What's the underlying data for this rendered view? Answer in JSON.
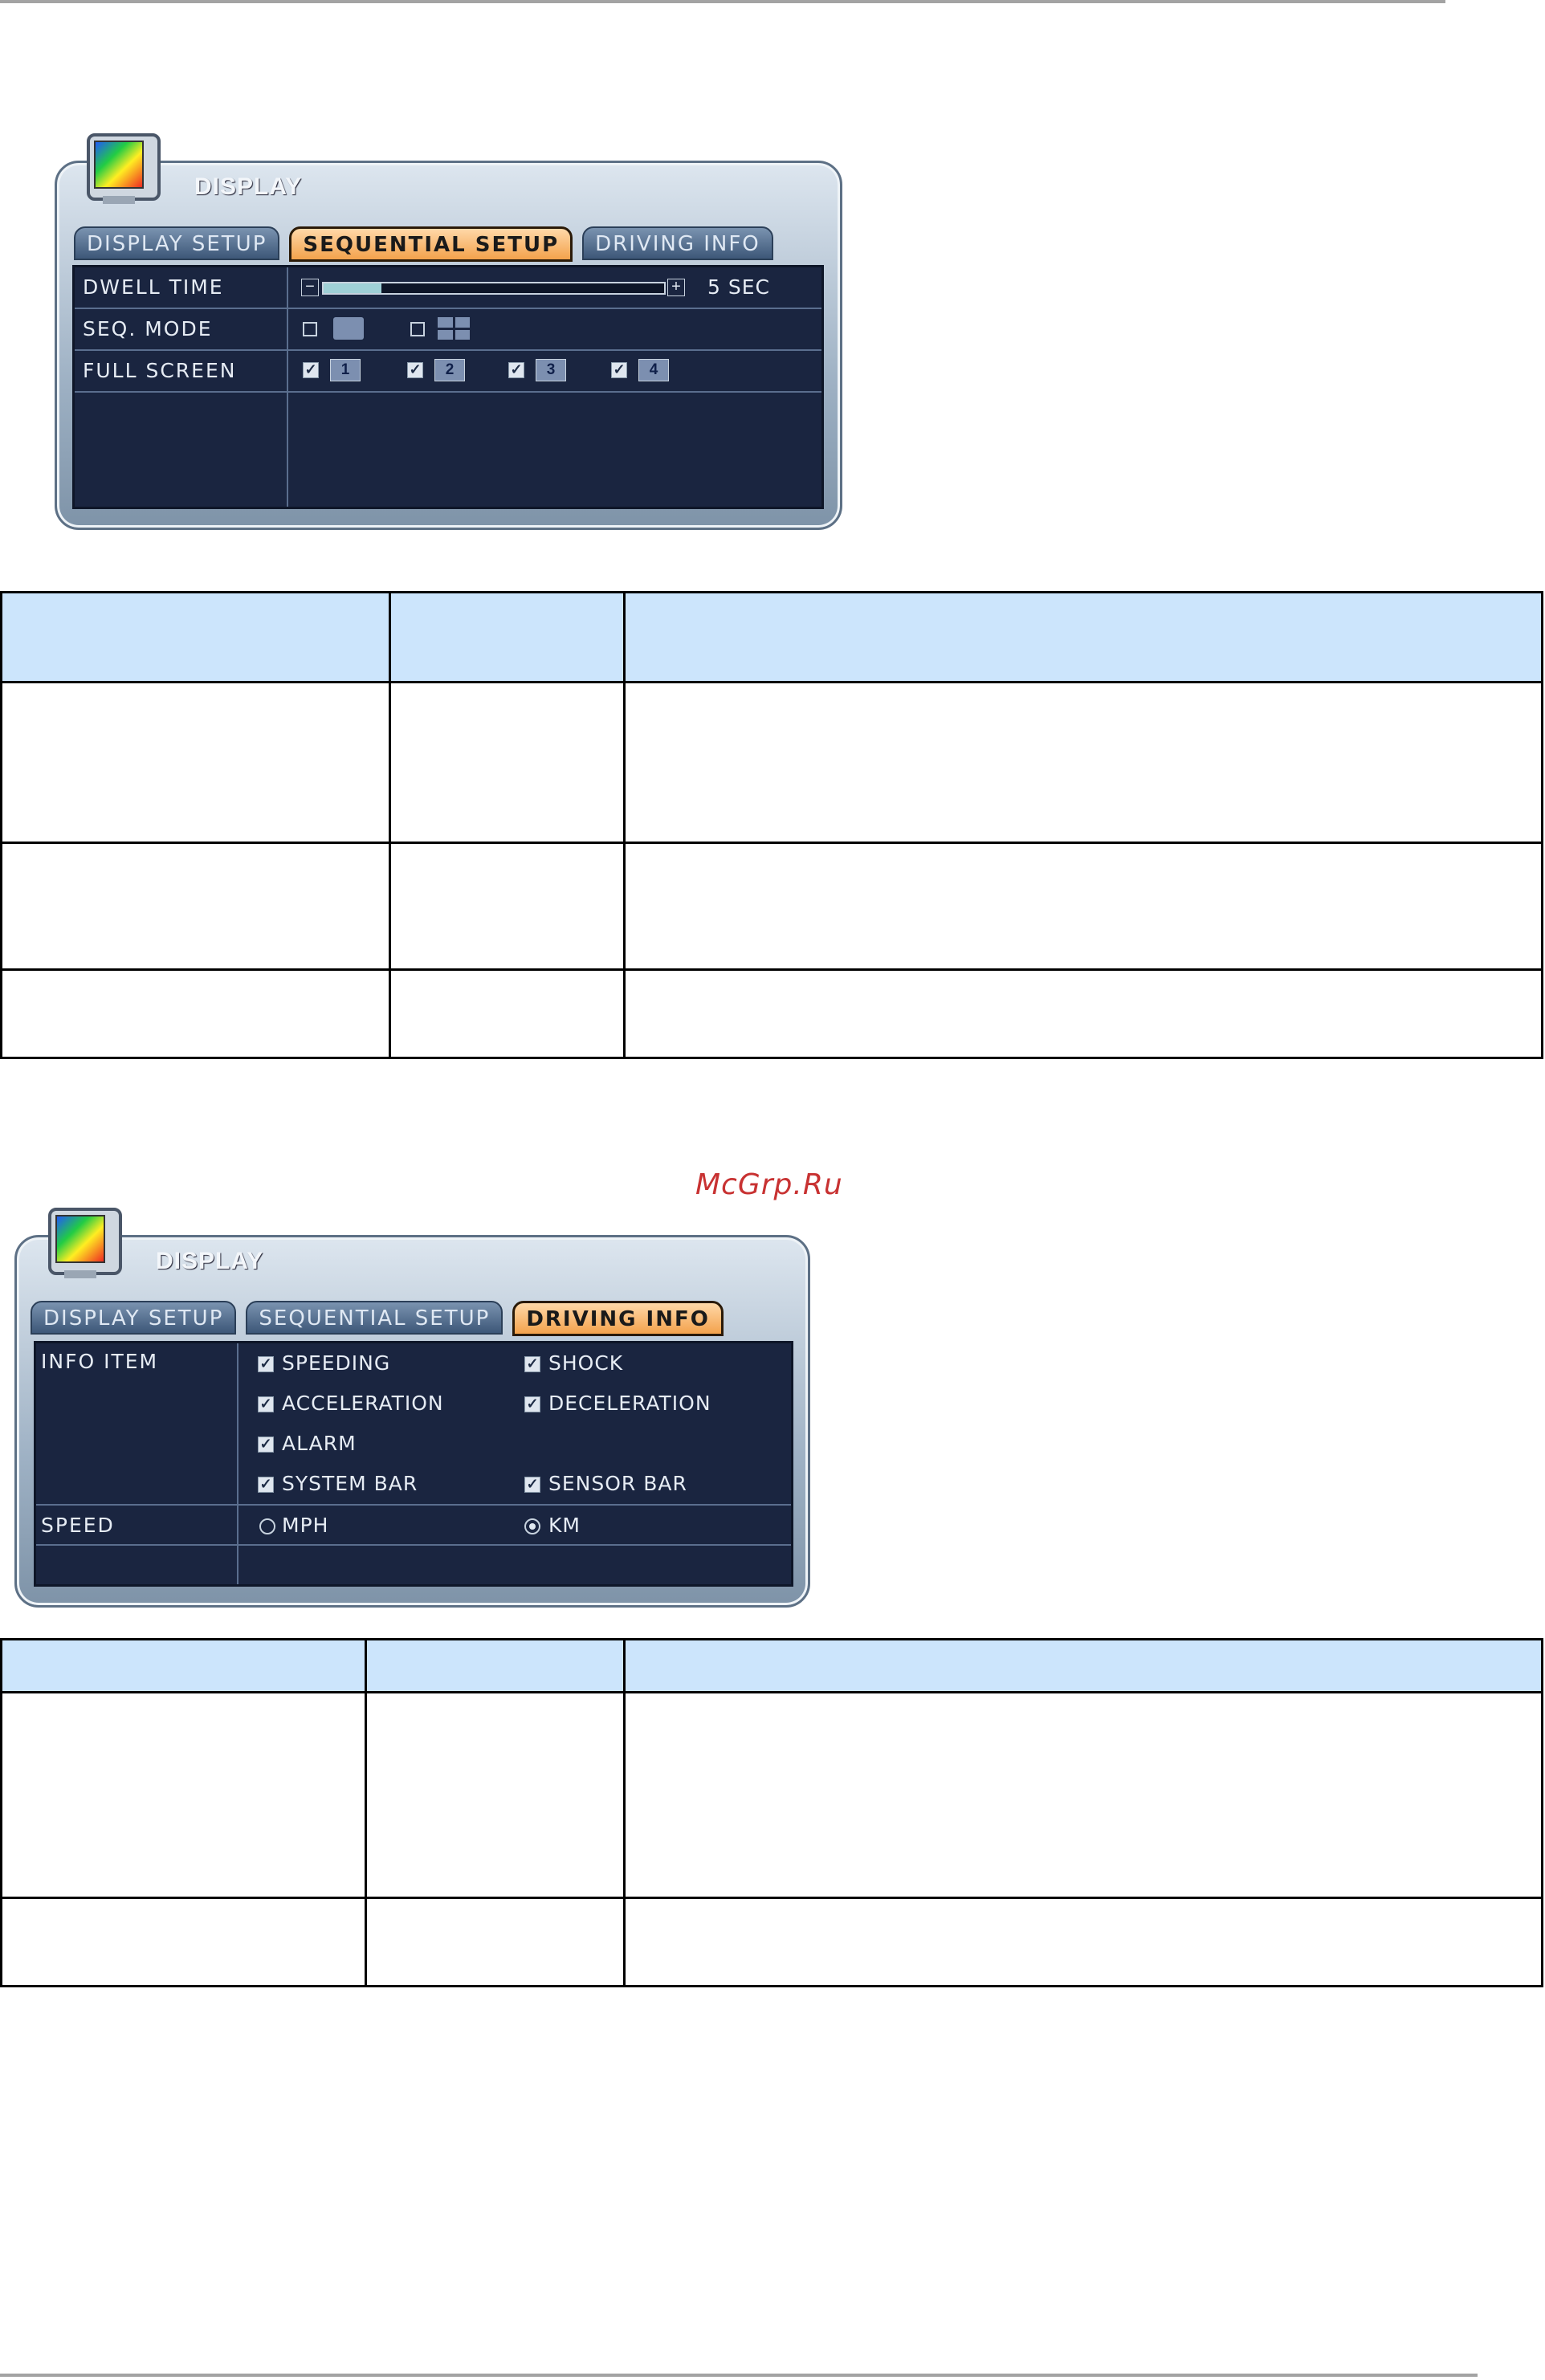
{
  "watermark": "McGrp.Ru",
  "screen1": {
    "title": "DISPLAY",
    "tabs": [
      "DISPLAY SETUP",
      "SEQUENTIAL SETUP",
      "DRIVING INFO"
    ],
    "active_tab": "SEQUENTIAL SETUP",
    "rows": {
      "dwell_time": {
        "label": "DWELL TIME",
        "value": "5 SEC",
        "level_fraction": 0.17
      },
      "seq_mode": {
        "label": "SEQ. MODE"
      },
      "full_screen": {
        "label": "FULL SCREEN",
        "channels": [
          "1",
          "2",
          "3",
          "4"
        ]
      }
    }
  },
  "screen2": {
    "title": "DISPLAY",
    "tabs": [
      "DISPLAY SETUP",
      "SEQUENTIAL SETUP",
      "DRIVING INFO"
    ],
    "active_tab": "DRIVING INFO",
    "info_item_label": "INFO ITEM",
    "info_items": [
      [
        "SPEEDING",
        "SHOCK"
      ],
      [
        "ACCELERATION",
        "DECELERATION"
      ],
      [
        "ALARM",
        ""
      ],
      [
        "SYSTEM BAR",
        "SENSOR BAR"
      ]
    ],
    "speed_label": "SPEED",
    "speed_options": [
      "MPH",
      "KM"
    ],
    "speed_selected": "KM"
  },
  "colors": {
    "header_fill": "#cce5fc",
    "tab_active": "#f3a24c",
    "panel_bg": "#1a2540"
  }
}
